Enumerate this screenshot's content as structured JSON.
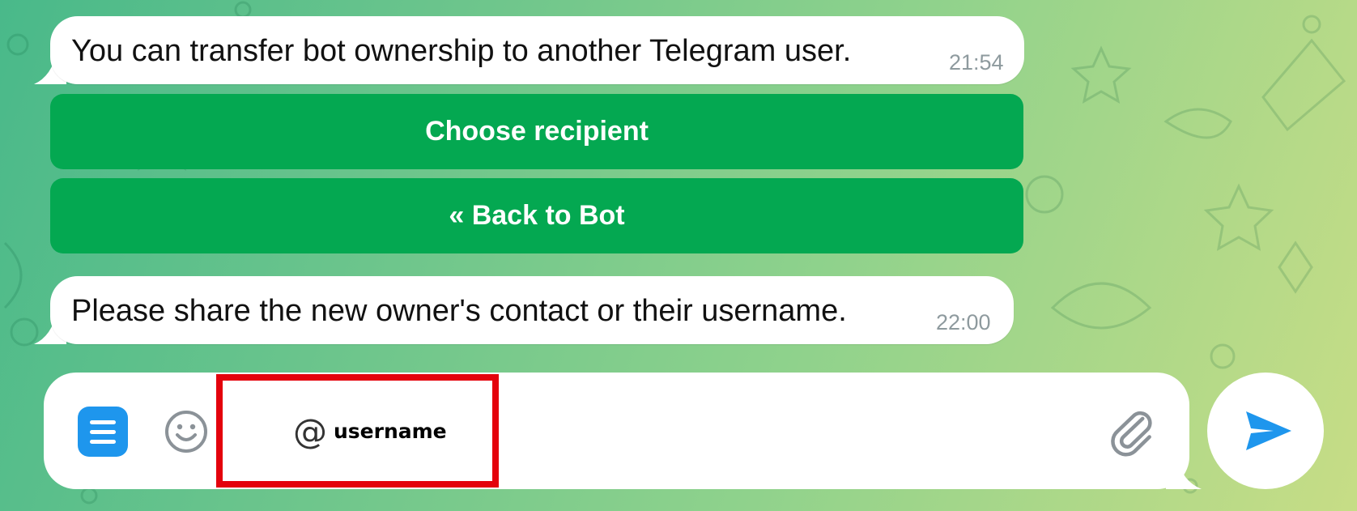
{
  "chat": {
    "messages": [
      {
        "text": "You can transfer bot ownership to another Telegram user.",
        "time": "21:54"
      },
      {
        "text": "Please share the new owner's contact or their username.",
        "time": "22:00"
      }
    ],
    "inline_buttons": [
      {
        "label": "Choose recipient"
      },
      {
        "label": "« Back to Bot"
      }
    ]
  },
  "composer": {
    "at_symbol": "@",
    "value": "username",
    "icons": {
      "menu": "menu-icon",
      "emoji": "emoji-icon",
      "attach": "paperclip-icon",
      "send": "send-icon"
    }
  },
  "colors": {
    "button_green": "#04a851",
    "accent_blue": "#1e96ed",
    "highlight_red": "#e4020c"
  }
}
